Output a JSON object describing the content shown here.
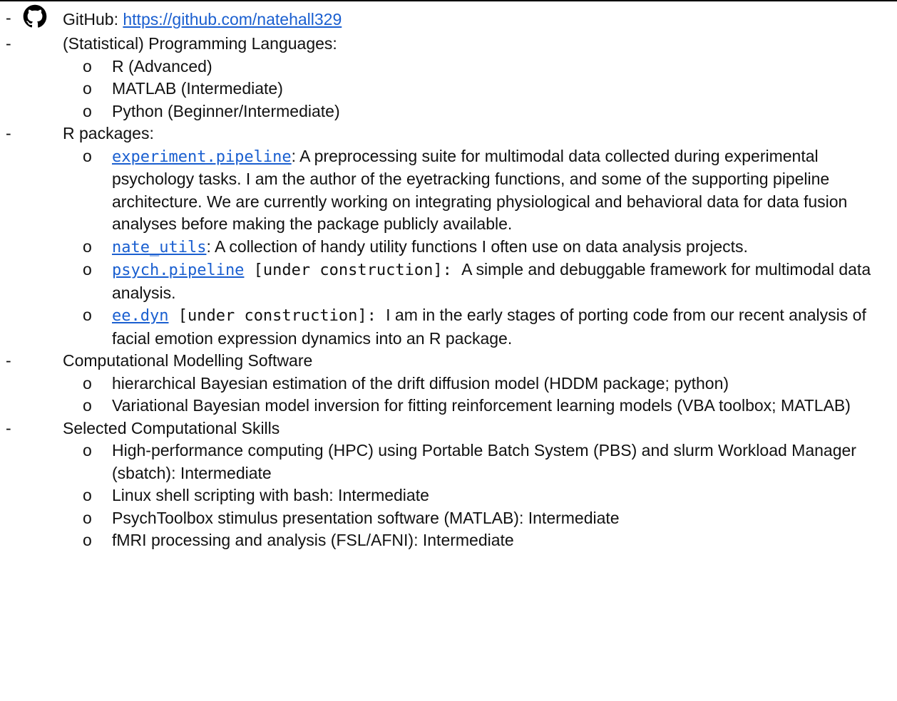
{
  "github": {
    "icon": "github-icon",
    "label": "GitHub: ",
    "url": "https://github.com/natehall329"
  },
  "languages": {
    "heading": "(Statistical) Programming Languages:",
    "items": [
      "R (Advanced)",
      "MATLAB (Intermediate)",
      "Python (Beginner/Intermediate)"
    ]
  },
  "packages": {
    "heading": "R packages:",
    "items": [
      {
        "name": "experiment.pipeline",
        "tag": "",
        "desc": ":  A preprocessing suite for multimodal data collected during experimental psychology tasks. I am the author of the eyetracking functions, and some of the supporting pipeline architecture. We are currently working on integrating physiological and behavioral data for data fusion analyses before making the package publicly available."
      },
      {
        "name": "nate_utils",
        "tag": "",
        "desc": ": A collection of handy utility functions I often use on data analysis projects."
      },
      {
        "name": "psych.pipeline",
        "tag": " [under construction]: ",
        "desc": " A simple and debuggable framework for multimodal data analysis."
      },
      {
        "name": "ee.dyn",
        "tag": " [under construction]: ",
        "desc": " I am in the early stages of porting code from our recent analysis of facial emotion expression dynamics into an R package."
      }
    ]
  },
  "modelling": {
    "heading": "Computational Modelling Software",
    "items": [
      "hierarchical Bayesian estimation of the drift diffusion model (HDDM package; python)",
      "Variational Bayesian model inversion for fitting reinforcement learning models (VBA toolbox; MATLAB)"
    ]
  },
  "skills": {
    "heading": "Selected Computational Skills",
    "items": [
      "High-performance computing (HPC) using Portable Batch System (PBS) and slurm Workload Manager (sbatch): Intermediate",
      "Linux shell scripting with bash: Intermediate",
      "PsychToolbox stimulus presentation software (MATLAB): Intermediate",
      "fMRI processing and analysis (FSL/AFNI): Intermediate"
    ]
  },
  "markers": {
    "dash": "-",
    "bullet": "o"
  }
}
